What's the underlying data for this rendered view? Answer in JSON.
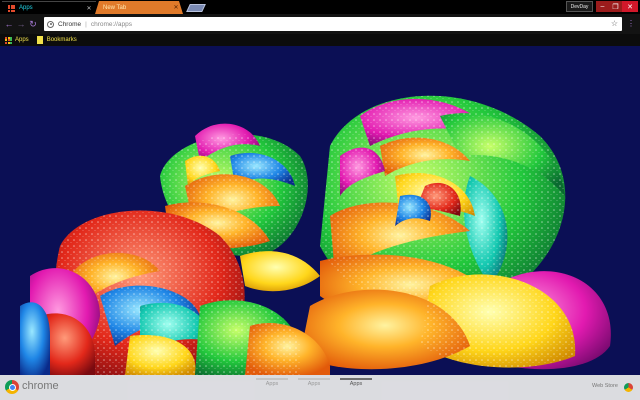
{
  "tabs": [
    {
      "label": "Apps",
      "active": true
    },
    {
      "label": "New Tab",
      "active": false
    }
  ],
  "window": {
    "profile_label": "DevDay",
    "minimize_icon": "minimize-icon",
    "maximize_icon": "maximize-icon",
    "close_icon": "close-icon"
  },
  "toolbar": {
    "back_icon": "back-arrow-icon",
    "forward_icon": "forward-arrow-icon",
    "reload_icon": "reload-icon",
    "omnibox": {
      "site_label": "Chrome",
      "separator": "|",
      "url": "chrome://apps"
    },
    "menu_icon": "kebab-menu-icon"
  },
  "bookmarks_bar": {
    "items": [
      {
        "label": "Apps",
        "icon": "apps-grid-icon"
      },
      {
        "label": "Bookmarks",
        "icon": "folder-icon"
      }
    ]
  },
  "content": {
    "background_color": "#0b0f55",
    "image_subject": "rainbow-roses-wallpaper"
  },
  "bottom_bar": {
    "brand": "chrome",
    "pages": [
      {
        "label": "Apps",
        "selected": false
      },
      {
        "label": "Apps",
        "selected": false
      },
      {
        "label": "Apps",
        "selected": true
      }
    ],
    "webstore_label": "Web Store"
  },
  "colors": {
    "tab_active_text": "#21d4e8",
    "new_tab_bg": "#e07a2a",
    "accent_purple": "#a87bd8",
    "bookmark_text": "#f1e14b",
    "close_red": "#d2182a"
  }
}
